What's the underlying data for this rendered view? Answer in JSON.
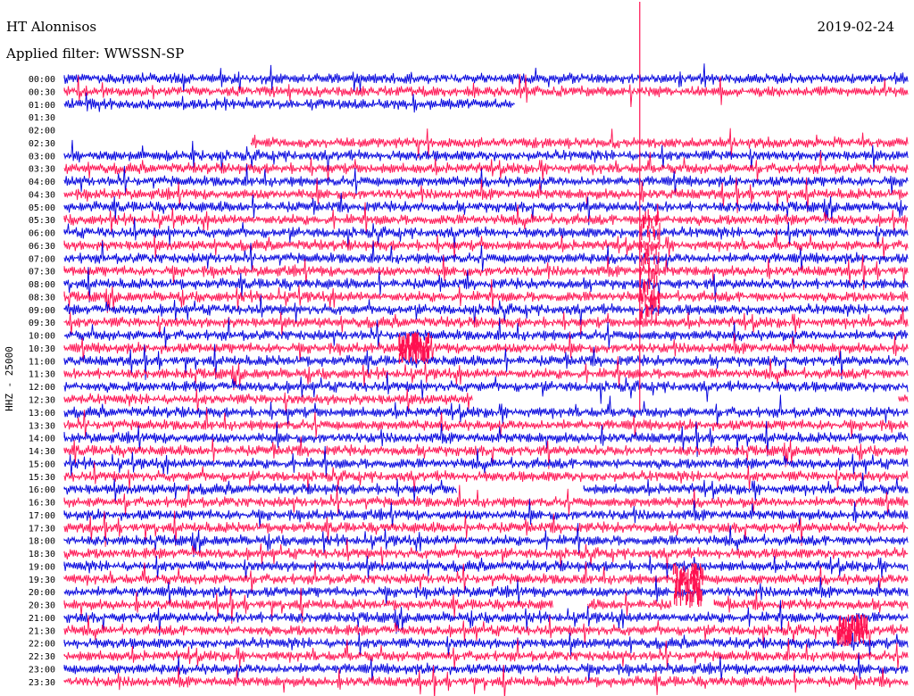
{
  "header": {
    "station": "HT Alonnisos",
    "date": "2019-02-24",
    "filter": "Applied filter: WWSSN-SP"
  },
  "chart_data": {
    "type": "line",
    "title": "HT Alonnisos",
    "subtitle": "Applied filter: WWSSN-SP",
    "date": "2019-02-24",
    "ylabel": "HHZ - 25000",
    "colors": [
      "#0000dd",
      "#ff1050"
    ],
    "row_labels": [
      "00:00",
      "00:30",
      "01:00",
      "01:30",
      "02:00",
      "02:30",
      "03:00",
      "03:30",
      "04:00",
      "04:30",
      "05:00",
      "05:30",
      "06:00",
      "06:30",
      "07:00",
      "07:30",
      "08:00",
      "08:30",
      "09:00",
      "09:30",
      "10:00",
      "10:30",
      "11:00",
      "11:30",
      "12:00",
      "12:30",
      "13:00",
      "13:30",
      "14:00",
      "14:30",
      "15:00",
      "15:30",
      "16:00",
      "16:30",
      "17:00",
      "17:30",
      "18:00",
      "18:30",
      "19:00",
      "19:30",
      "20:00",
      "20:30",
      "21:00",
      "21:30",
      "22:00",
      "22:30",
      "23:00",
      "23:30"
    ],
    "gaps": [
      {
        "row": "01:00",
        "from": 0.535,
        "to": 1.0
      },
      {
        "row": "01:30",
        "from": 0.0,
        "to": 1.0
      },
      {
        "row": "02:00",
        "from": 0.0,
        "to": 1.0
      },
      {
        "row": "02:30",
        "from": 0.0,
        "to": 0.22
      },
      {
        "row": "12:30",
        "from": 0.485,
        "to": 0.99
      },
      {
        "row": "16:00",
        "from": 0.465,
        "to": 0.615
      },
      {
        "row": "20:30",
        "from": 0.58,
        "to": 0.62
      },
      {
        "row": "20:30",
        "from": 0.72,
        "to": 0.77
      }
    ],
    "events": [
      {
        "row": "05:30",
        "position": 0.695,
        "rows": 8
      },
      {
        "row": "10:30",
        "position": 0.415,
        "rows": 1
      },
      {
        "row": "19:30",
        "position": 0.74,
        "rows": 2
      },
      {
        "row": "21:30",
        "position": 0.935,
        "rows": 1
      }
    ]
  }
}
